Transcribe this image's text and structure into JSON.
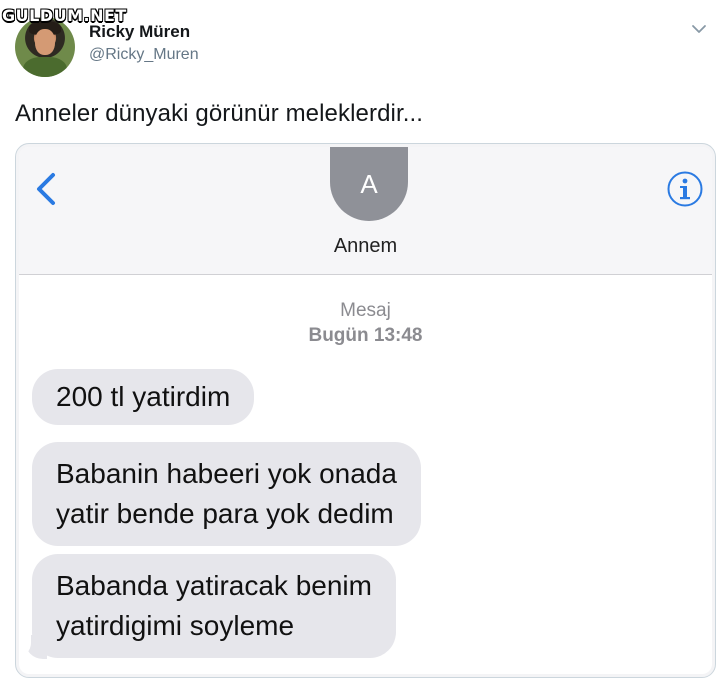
{
  "watermark": "GULDUM.NET",
  "tweet": {
    "author_name": "Ricky Müren",
    "author_handle": "@Ricky_Muren",
    "text": "Anneler dünyaki görünür meleklerdir..."
  },
  "icons": {
    "caret": "chevron-down-icon",
    "back": "chevron-left-icon",
    "info": "info-icon"
  },
  "sms": {
    "contact_initial": "A",
    "contact_name": "Annem",
    "thread_label": "Mesaj",
    "thread_time": "Bugün 13:48",
    "messages": [
      "200 tl yatirdim",
      "Babanin habeeri yok onada\nyatir bende para yok dedim",
      "Babanda yatiracak  benim\nyatirdigimi soyleme"
    ]
  },
  "colors": {
    "ios_blue": "#2a7ae2",
    "bubble_gray": "#e6e6eb",
    "handle_gray": "#657786"
  }
}
